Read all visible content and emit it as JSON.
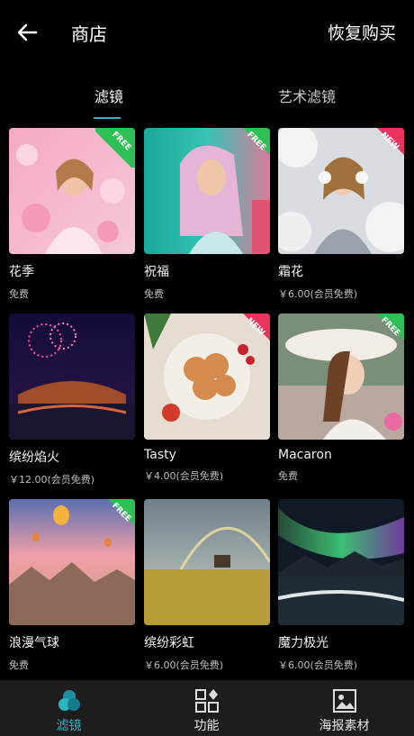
{
  "header": {
    "title": "商店",
    "restore_label": "恢复购买"
  },
  "tabs": [
    {
      "label": "滤镜",
      "active": true
    },
    {
      "label": "艺术滤镜",
      "active": false
    }
  ],
  "items": [
    {
      "name": "花季",
      "price": "免费",
      "badge": "FREE"
    },
    {
      "name": "祝福",
      "price": "免费",
      "badge": "FREE"
    },
    {
      "name": "霜花",
      "price": "￥6.00(会员免费)",
      "badge": "NEW"
    },
    {
      "name": "缤纷焰火",
      "price": "￥12.00(会员免费)",
      "badge": ""
    },
    {
      "name": "Tasty",
      "price": "￥4.00(会员免费)",
      "badge": "NEW"
    },
    {
      "name": "Macaron",
      "price": "免费",
      "badge": "FREE"
    },
    {
      "name": "浪漫气球",
      "price": "免费",
      "badge": "FREE"
    },
    {
      "name": "缤纷彩虹",
      "price": "￥6.00(会员免费)",
      "badge": ""
    },
    {
      "name": "魔力极光",
      "price": "￥6.00(会员免费)",
      "badge": ""
    }
  ],
  "bottom_nav": [
    {
      "label": "滤镜",
      "icon": "filter-circles-icon",
      "active": true
    },
    {
      "label": "功能",
      "icon": "grid-functions-icon",
      "active": false
    },
    {
      "label": "海报素材",
      "icon": "image-frame-icon",
      "active": false
    }
  ],
  "colors": {
    "accent": "#2bb3c0",
    "free_badge": "#2fbf57",
    "new_badge": "#e8345e",
    "bottom_bar": "#1d1d1d"
  }
}
